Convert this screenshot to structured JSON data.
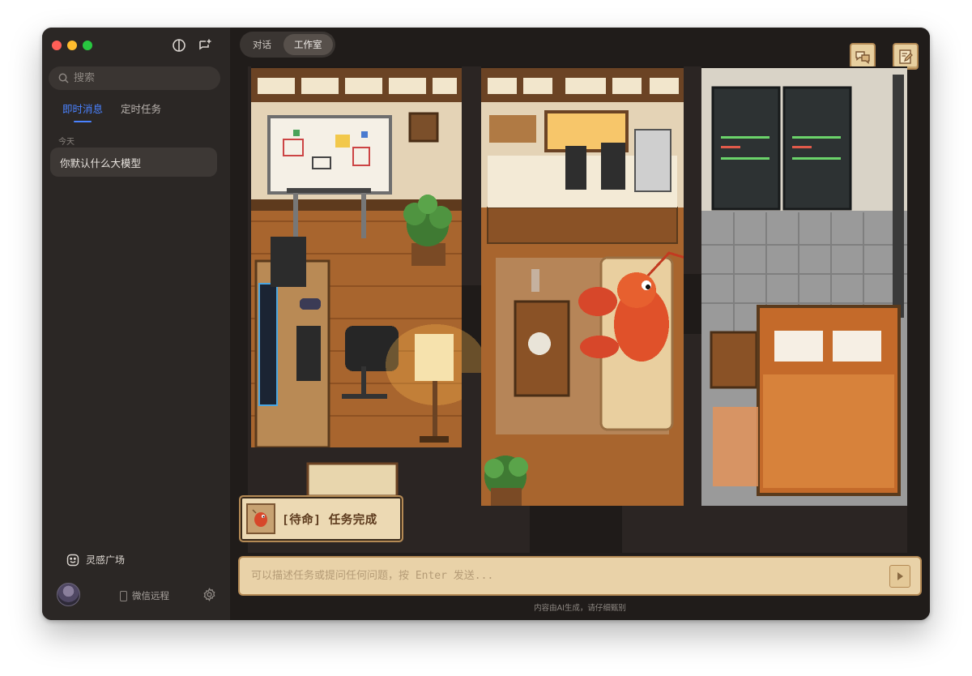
{
  "sidebar": {
    "search_placeholder": "搜索",
    "tabs": [
      {
        "label": "即时消息",
        "active": true
      },
      {
        "label": "定时任务",
        "active": false
      }
    ],
    "group_label": "今天",
    "conversations": [
      {
        "title": "你默认什么大模型"
      }
    ],
    "inspiration_label": "灵感广场",
    "wechat_label": "微信远程"
  },
  "main": {
    "segments": [
      {
        "label": "对话",
        "active": false
      },
      {
        "label": "工作室",
        "active": true
      }
    ],
    "status": {
      "text": "[待命] 任务完成"
    },
    "input_placeholder": "可以描述任务或提问任何问题，按 Enter 发送...",
    "disclaimer": "内容由AI生成，请仔细甄别"
  },
  "colors": {
    "accent": "#4a82ff",
    "window_bg": "#2a2624",
    "pixel_panel": "#e9d2a8",
    "pixel_border": "#b48a55"
  },
  "icons": {
    "sidebar_toggle": "sidebar-toggle-icon",
    "new_chat": "new-chat-icon",
    "search": "search-icon",
    "inspiration": "smile-icon",
    "wechat": "phone-icon",
    "settings": "gear-icon",
    "chat_bubbles": "chat-bubbles-icon",
    "notepad": "notepad-edit-icon",
    "send": "send-arrow-icon"
  }
}
